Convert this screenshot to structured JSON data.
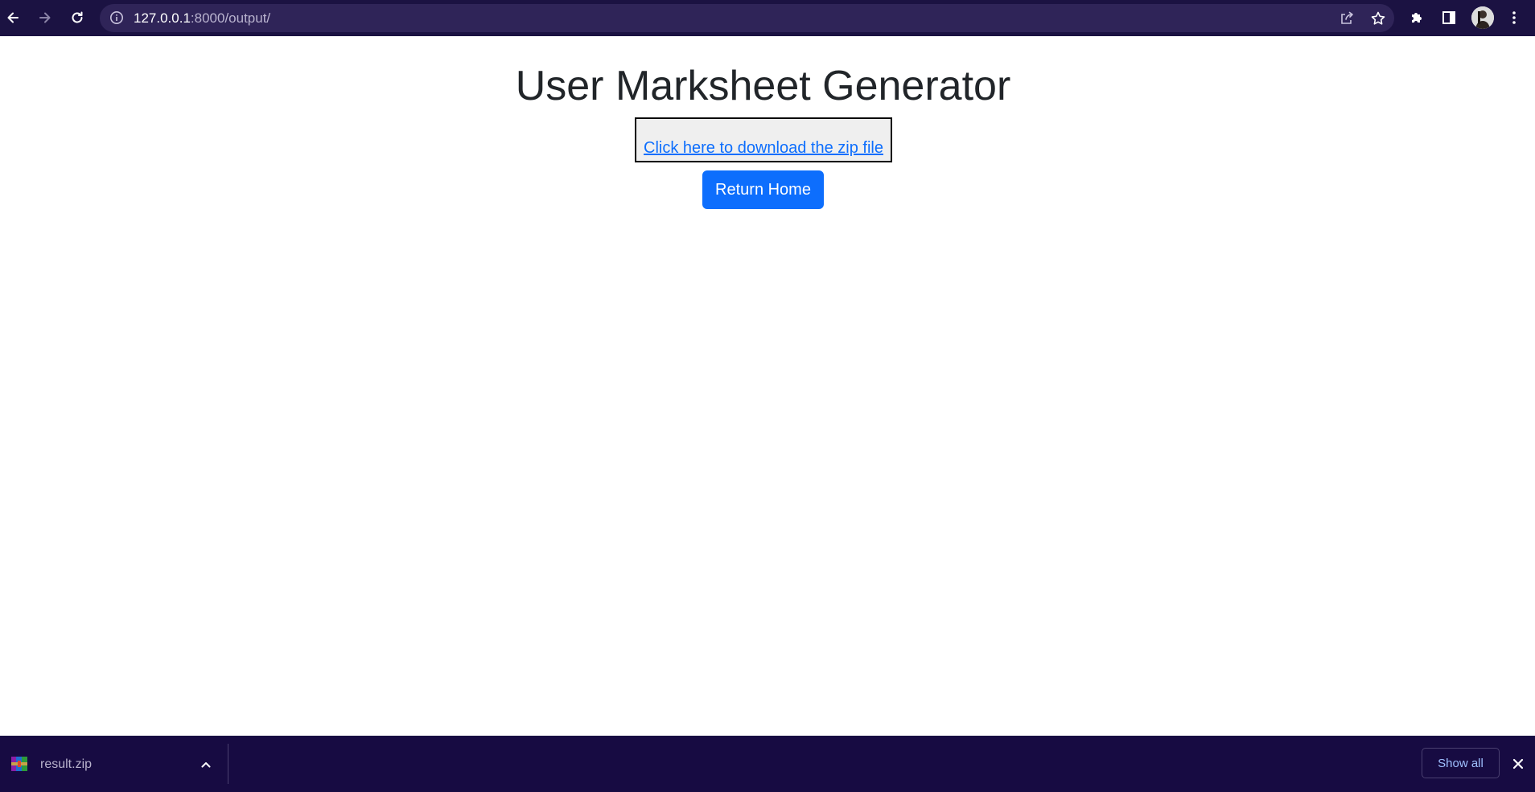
{
  "browser": {
    "url_host": "127.0.0.1",
    "url_rest": ":8000/output/"
  },
  "page": {
    "title": "User Marksheet Generator",
    "download_link": "Click here to download the zip file",
    "return_button": "Return Home"
  },
  "download_shelf": {
    "filename": "result.zip",
    "show_all": "Show all"
  },
  "colors": {
    "toolbar_bg": "#1b1242",
    "omnibox_bg": "#2f2458",
    "shelf_bg": "#170b42",
    "primary_button": "#0d6efd",
    "link": "#0d6efd"
  }
}
